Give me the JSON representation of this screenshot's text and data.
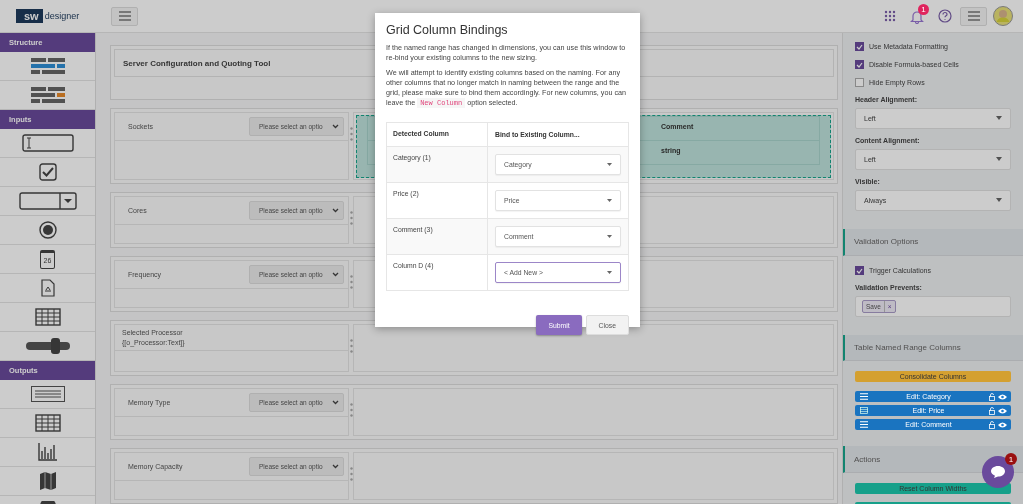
{
  "header": {
    "logo_mark": "sw",
    "logo_text": "designer",
    "notifications": "1"
  },
  "sidebar": [
    {
      "title": "Structure",
      "items": [
        {
          "kind": "table-header"
        },
        {
          "kind": "table-highlight"
        }
      ]
    },
    {
      "title": "Inputs",
      "items": [
        {
          "kind": "text-input"
        },
        {
          "kind": "checkbox"
        },
        {
          "kind": "dropdown"
        },
        {
          "kind": "radio"
        },
        {
          "kind": "calendar",
          "text": "26"
        },
        {
          "kind": "file"
        },
        {
          "kind": "grid"
        },
        {
          "kind": "slider"
        }
      ]
    },
    {
      "title": "Outputs",
      "items": [
        {
          "kind": "text-output"
        },
        {
          "kind": "grid"
        },
        {
          "kind": "bar-chart"
        },
        {
          "kind": "map"
        },
        {
          "kind": "circle"
        }
      ]
    }
  ],
  "canvas": {
    "title": "Server Configuration and Quoting Tool",
    "rows": [
      {
        "kind": "select",
        "label": "Sockets",
        "placeholder": "Please select an optio",
        "grid": {
          "columns": [
            "Comment"
          ],
          "cells": [
            "string"
          ]
        }
      },
      {
        "kind": "select",
        "label": "Cores",
        "placeholder": "Please select an optio"
      },
      {
        "kind": "select",
        "label": "Frequency",
        "placeholder": "Please select an optio"
      },
      {
        "kind": "text",
        "label": "Selected Processor",
        "value": "{[o_Processor:Text]}"
      },
      {
        "kind": "select",
        "label": "Memory Type",
        "placeholder": "Please select an optio"
      },
      {
        "kind": "select",
        "label": "Memory Capacity",
        "placeholder": "Please select an optio"
      }
    ]
  },
  "properties": [
    {
      "kind": "checkbox",
      "label": "Use Metadata Formatting",
      "checked": true
    },
    {
      "kind": "checkbox",
      "label": "Disable Formula-based Cells",
      "checked": true
    },
    {
      "kind": "checkbox",
      "label": "Hide Empty Rows",
      "checked": false
    },
    {
      "kind": "select",
      "label": "Header Alignment:",
      "value": "Left"
    },
    {
      "kind": "select",
      "label": "Content Alignment:",
      "value": "Left"
    },
    {
      "kind": "select",
      "label": "Visible:",
      "value": "Always"
    },
    {
      "kind": "section",
      "label": "Validation Options"
    },
    {
      "kind": "checkbox",
      "label": "Trigger Calculations",
      "checked": true
    },
    {
      "kind": "tags",
      "label": "Validation Prevents:",
      "tags": [
        "Save"
      ],
      "remove": "×"
    },
    {
      "kind": "section",
      "label": "Table Named Range Columns"
    },
    {
      "kind": "button",
      "label": "Consolidate Columns",
      "color": "#d4a030"
    },
    {
      "kind": "column",
      "label": "Edit: Category"
    },
    {
      "kind": "gridcolumn",
      "label": "Edit: Price"
    },
    {
      "kind": "column",
      "label": "Edit: Comment"
    },
    {
      "kind": "section",
      "label": "Actions"
    },
    {
      "kind": "button",
      "label": "Reset Column Widths",
      "color": "#16a08a"
    },
    {
      "kind": "strip",
      "color": "#16a08a"
    }
  ],
  "chat": {
    "badge": "1"
  },
  "modal": {
    "title": "Grid Column Bindings",
    "intro": "If the named range has changed in dimensions, you can use this window to re-bind your existing columns to the new sizing.",
    "note": {
      "before": "We will attempt to identify existing columns based on the naming. For any other columns that no longer match in naming between the range and the grid, please make sure to bind them accordingly. For new columns, you can leave the",
      "code": "New Column",
      "after": "option selected."
    },
    "columns": [
      "Detected Column",
      "Bind to Existing Column..."
    ],
    "rows": [
      {
        "detected": "Category (1)",
        "binding": "Category",
        "focused": false
      },
      {
        "detected": "Price (2)",
        "binding": "Price",
        "focused": false
      },
      {
        "detected": "Comment (3)",
        "binding": "Comment",
        "focused": false
      },
      {
        "detected": "Column D (4)",
        "binding": "< Add New >",
        "focused": true
      }
    ],
    "buttons": [
      {
        "kind": "primary",
        "label": "Submit"
      },
      {
        "kind": "secondary",
        "label": "Close"
      }
    ]
  }
}
